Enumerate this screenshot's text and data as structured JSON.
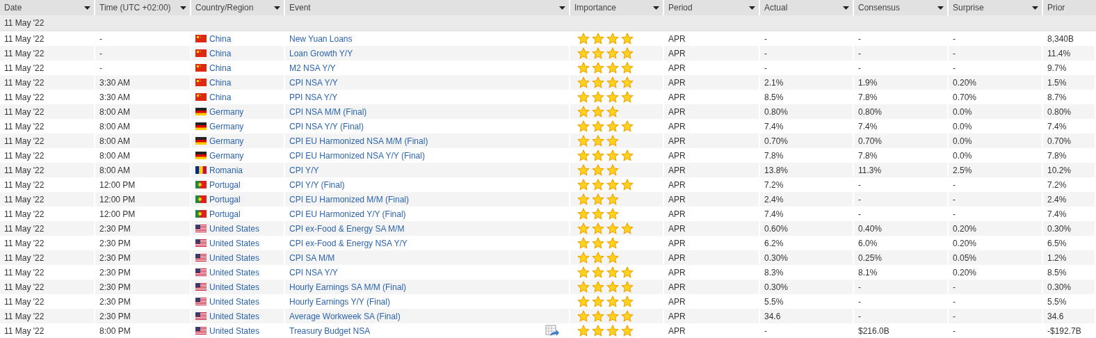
{
  "columns": [
    {
      "label": "Date",
      "filter": true
    },
    {
      "label": "Time (UTC +02:00)",
      "filter": true
    },
    {
      "label": "Country/Region",
      "filter": true
    },
    {
      "label": "Event",
      "filter": true
    },
    {
      "label": "Importance",
      "filter": true
    },
    {
      "label": "Period",
      "filter": true
    },
    {
      "label": "Actual",
      "filter": true
    },
    {
      "label": "Consensus",
      "filter": true
    },
    {
      "label": "Surprise",
      "filter": true
    },
    {
      "label": "Prior",
      "filter": false
    }
  ],
  "group": "11 May '22",
  "rows": [
    {
      "date": "11 May '22",
      "time": "-",
      "kind": "cn",
      "country": "China",
      "event": "New Yuan Loans",
      "export": false,
      "stars": 4,
      "period": "APR",
      "actual": "-",
      "consensus": "-",
      "surprise": "-",
      "prior": "8,340B"
    },
    {
      "date": "11 May '22",
      "time": "-",
      "kind": "cn",
      "country": "China",
      "event": "Loan Growth Y/Y",
      "export": false,
      "stars": 4,
      "period": "APR",
      "actual": "-",
      "consensus": "-",
      "surprise": "-",
      "prior": "11.4%"
    },
    {
      "date": "11 May '22",
      "time": "-",
      "kind": "cn",
      "country": "China",
      "event": "M2 NSA Y/Y",
      "export": false,
      "stars": 4,
      "period": "APR",
      "actual": "-",
      "consensus": "-",
      "surprise": "-",
      "prior": "9.7%"
    },
    {
      "date": "11 May '22",
      "time": "3:30 AM",
      "kind": "cn",
      "country": "China",
      "event": "CPI NSA Y/Y",
      "export": false,
      "stars": 4,
      "period": "APR",
      "actual": "2.1%",
      "consensus": "1.9%",
      "surprise": "0.20%",
      "prior": "1.5%"
    },
    {
      "date": "11 May '22",
      "time": "3:30 AM",
      "kind": "cn",
      "country": "China",
      "event": "PPI NSA Y/Y",
      "export": false,
      "stars": 4,
      "period": "APR",
      "actual": "8.5%",
      "consensus": "7.8%",
      "surprise": "0.70%",
      "prior": "8.7%"
    },
    {
      "date": "11 May '22",
      "time": "8:00 AM",
      "kind": "de",
      "country": "Germany",
      "event": "CPI NSA M/M (Final)",
      "export": false,
      "stars": 3,
      "period": "APR",
      "actual": "0.80%",
      "consensus": "0.80%",
      "surprise": "0.0%",
      "prior": "0.80%"
    },
    {
      "date": "11 May '22",
      "time": "8:00 AM",
      "kind": "de",
      "country": "Germany",
      "event": "CPI NSA Y/Y (Final)",
      "export": false,
      "stars": 4,
      "period": "APR",
      "actual": "7.4%",
      "consensus": "7.4%",
      "surprise": "0.0%",
      "prior": "7.4%"
    },
    {
      "date": "11 May '22",
      "time": "8:00 AM",
      "kind": "de",
      "country": "Germany",
      "event": "CPI EU Harmonized NSA M/M (Final)",
      "export": false,
      "stars": 3,
      "period": "APR",
      "actual": "0.70%",
      "consensus": "0.70%",
      "surprise": "0.0%",
      "prior": "0.70%"
    },
    {
      "date": "11 May '22",
      "time": "8:00 AM",
      "kind": "de",
      "country": "Germany",
      "event": "CPI EU Harmonized NSA Y/Y (Final)",
      "export": false,
      "stars": 4,
      "period": "APR",
      "actual": "7.8%",
      "consensus": "7.8%",
      "surprise": "0.0%",
      "prior": "7.8%"
    },
    {
      "date": "11 May '22",
      "time": "8:00 AM",
      "kind": "ro",
      "country": "Romania",
      "event": "CPI Y/Y",
      "export": false,
      "stars": 3,
      "period": "APR",
      "actual": "13.8%",
      "consensus": "11.3%",
      "surprise": "2.5%",
      "prior": "10.2%"
    },
    {
      "date": "11 May '22",
      "time": "12:00 PM",
      "kind": "pt",
      "country": "Portugal",
      "event": "CPI Y/Y (Final)",
      "export": false,
      "stars": 4,
      "period": "APR",
      "actual": "7.2%",
      "consensus": "-",
      "surprise": "-",
      "prior": "7.2%"
    },
    {
      "date": "11 May '22",
      "time": "12:00 PM",
      "kind": "pt",
      "country": "Portugal",
      "event": "CPI EU Harmonized M/M (Final)",
      "export": false,
      "stars": 3,
      "period": "APR",
      "actual": "2.4%",
      "consensus": "-",
      "surprise": "-",
      "prior": "2.4%"
    },
    {
      "date": "11 May '22",
      "time": "12:00 PM",
      "kind": "pt",
      "country": "Portugal",
      "event": "CPI EU Harmonized Y/Y (Final)",
      "export": false,
      "stars": 3,
      "period": "APR",
      "actual": "7.4%",
      "consensus": "-",
      "surprise": "-",
      "prior": "7.4%"
    },
    {
      "date": "11 May '22",
      "time": "2:30 PM",
      "kind": "us",
      "country": "United States",
      "event": "CPI ex-Food & Energy SA M/M",
      "export": false,
      "stars": 4,
      "period": "APR",
      "actual": "0.60%",
      "consensus": "0.40%",
      "surprise": "0.20%",
      "prior": "0.30%"
    },
    {
      "date": "11 May '22",
      "time": "2:30 PM",
      "kind": "us",
      "country": "United States",
      "event": "CPI ex-Food & Energy NSA Y/Y",
      "export": false,
      "stars": 3,
      "period": "APR",
      "actual": "6.2%",
      "consensus": "6.0%",
      "surprise": "0.20%",
      "prior": "6.5%"
    },
    {
      "date": "11 May '22",
      "time": "2:30 PM",
      "kind": "us",
      "country": "United States",
      "event": "CPI SA M/M",
      "export": false,
      "stars": 3,
      "period": "APR",
      "actual": "0.30%",
      "consensus": "0.25%",
      "surprise": "0.05%",
      "prior": "1.2%"
    },
    {
      "date": "11 May '22",
      "time": "2:30 PM",
      "kind": "us",
      "country": "United States",
      "event": "CPI NSA Y/Y",
      "export": false,
      "stars": 4,
      "period": "APR",
      "actual": "8.3%",
      "consensus": "8.1%",
      "surprise": "0.20%",
      "prior": "8.5%"
    },
    {
      "date": "11 May '22",
      "time": "2:30 PM",
      "kind": "us",
      "country": "United States",
      "event": "Hourly Earnings SA M/M (Final)",
      "export": false,
      "stars": 4,
      "period": "APR",
      "actual": "0.30%",
      "consensus": "-",
      "surprise": "-",
      "prior": "0.30%"
    },
    {
      "date": "11 May '22",
      "time": "2:30 PM",
      "kind": "us",
      "country": "United States",
      "event": "Hourly Earnings Y/Y (Final)",
      "export": false,
      "stars": 4,
      "period": "APR",
      "actual": "5.5%",
      "consensus": "-",
      "surprise": "-",
      "prior": "5.5%"
    },
    {
      "date": "11 May '22",
      "time": "2:30 PM",
      "kind": "us",
      "country": "United States",
      "event": "Average Workweek SA (Final)",
      "export": false,
      "stars": 4,
      "period": "APR",
      "actual": "34.6",
      "consensus": "-",
      "surprise": "-",
      "prior": "34.6"
    },
    {
      "date": "11 May '22",
      "time": "8:00 PM",
      "kind": "us",
      "country": "United States",
      "event": "Treasury Budget NSA",
      "export": true,
      "stars": 4,
      "period": "APR",
      "actual": "-",
      "consensus": "$216.0B",
      "surprise": "-",
      "prior": "-$192.7B"
    }
  ]
}
